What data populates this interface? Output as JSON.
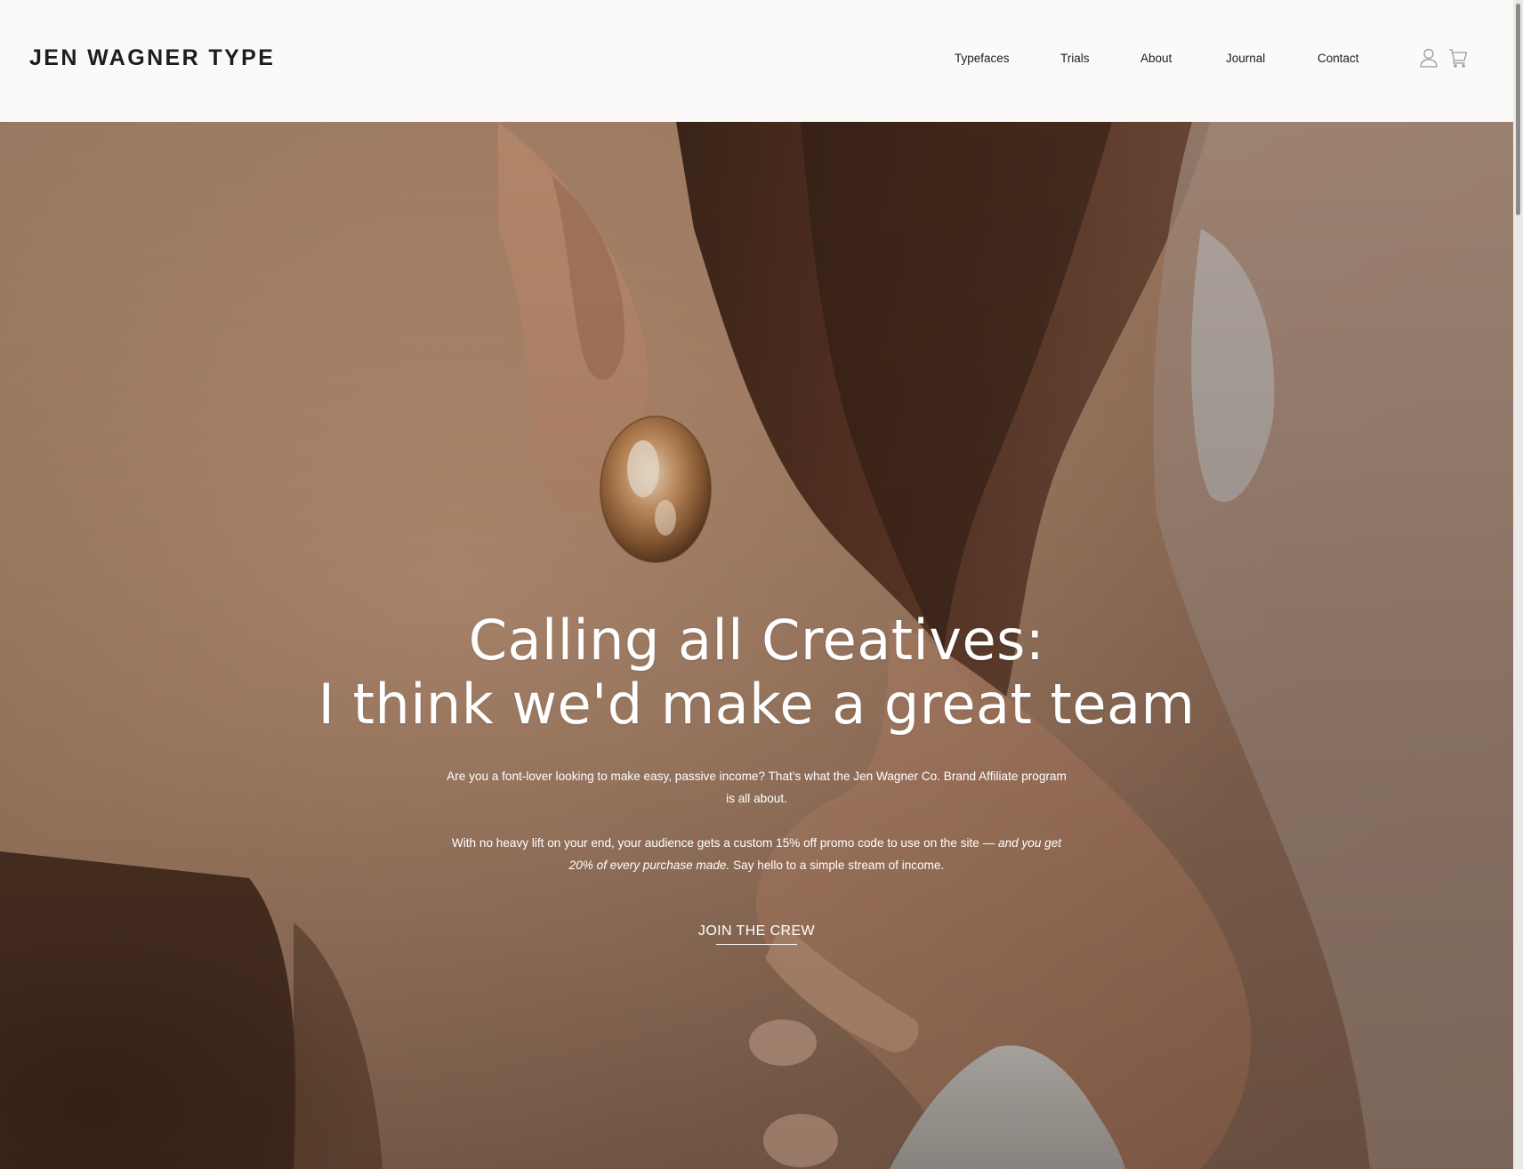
{
  "header": {
    "logo": "JEN WAGNER TYPE",
    "nav": {
      "typefaces": "Typefaces",
      "trials": "Trials",
      "about": "About",
      "journal": "Journal",
      "contact": "Contact"
    },
    "icons": {
      "account": "user-icon",
      "cart": "cart-icon"
    }
  },
  "hero": {
    "headline_line1": "Calling all Creatives:",
    "headline_line2": "I think we'd make a great team",
    "paragraph1": "Are you a font-lover looking to make easy, passive income? That’s what the Jen Wagner Co. Brand Affiliate program is all about.",
    "paragraph2_lead": "With no heavy lift on your end, your audience gets a custom 15% off promo code to use on the site —",
    "paragraph2_emphasis": "and you get 20% of every purchase made.",
    "paragraph2_tail": "Say hello to a simple stream of income.",
    "cta_label": "JOIN THE CREW",
    "image": "earring-close-up-photo"
  },
  "colors": {
    "header_bg": "#fbfaf8",
    "text_dark": "#1d1d1b",
    "hero_text": "#ffffff",
    "icon_gray": "#9a9a9a"
  }
}
